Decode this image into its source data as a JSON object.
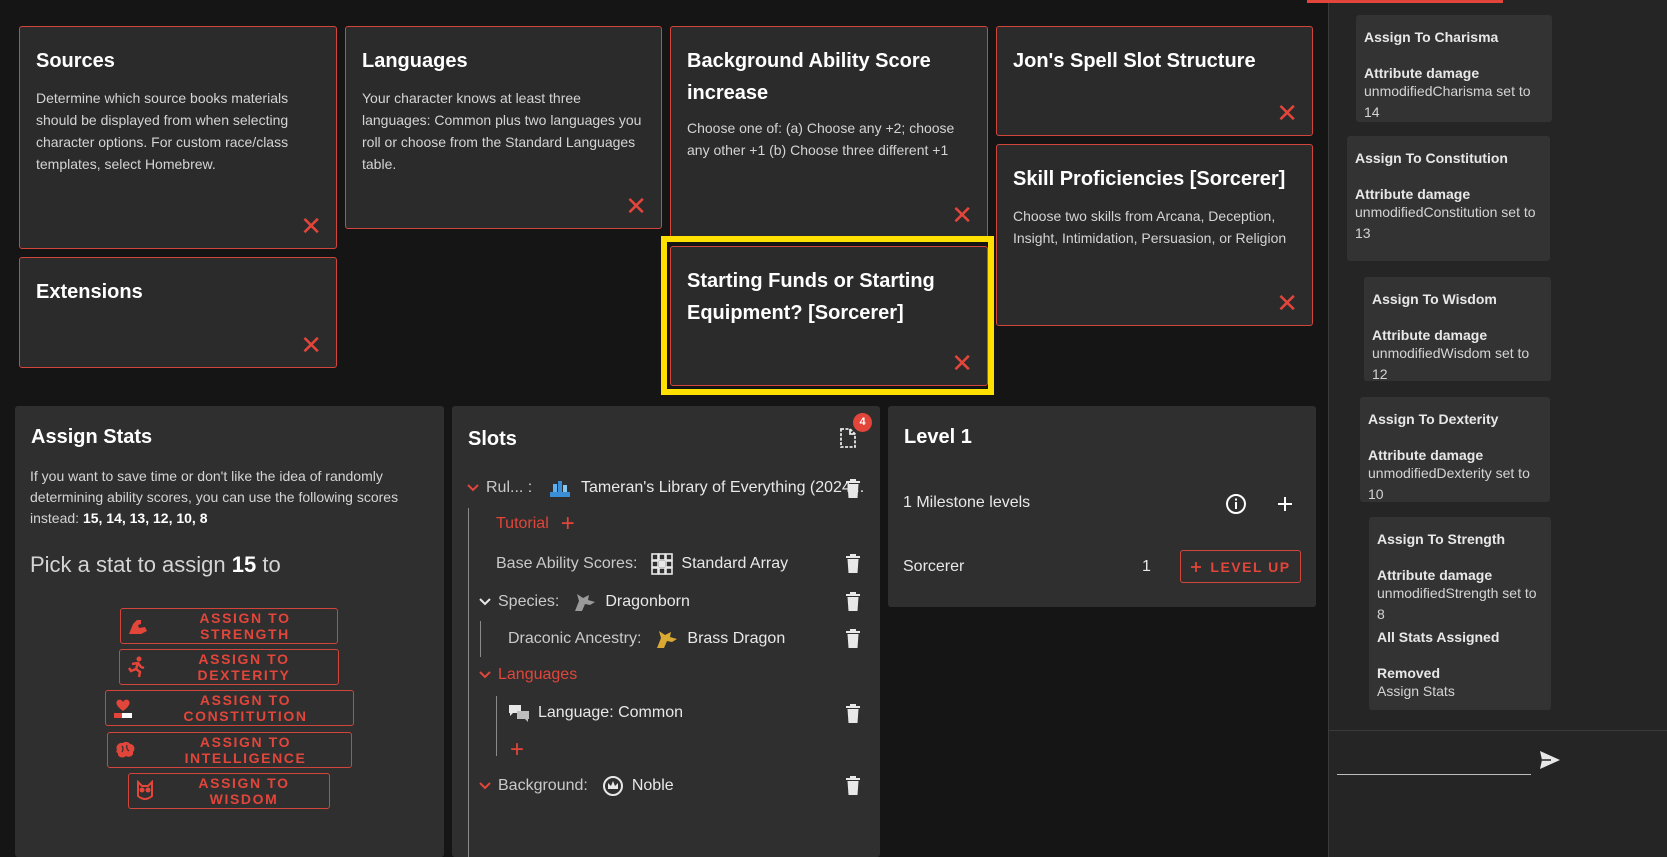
{
  "cards": {
    "sources": {
      "title": "Sources",
      "text": "Determine which source books materials should be displayed from when selecting character options. For custom race/class templates, select Homebrew."
    },
    "languages": {
      "title": "Languages",
      "text": "Your character knows at least three languages: Common plus two languages you roll or choose from the Standard Languages table."
    },
    "background_asi": {
      "title": "Background Ability Score increase",
      "text": "Choose one of: (a) Choose any +2; choose any other +1 (b) Choose three different +1"
    },
    "spell_slot": {
      "title": "Jon's Spell Slot Structure"
    },
    "skill_prof": {
      "title": "Skill Proficiencies [Sorcerer]",
      "text": "Choose two skills from Arcana, Deception, Insight, Intimidation, Persuasion, or Religion"
    },
    "extensions": {
      "title": "Extensions"
    },
    "starting_funds": {
      "title": "Starting Funds or Starting Equipment? [Sorcerer]"
    },
    "close_glyph": "✕"
  },
  "assign_stats": {
    "title": "Assign Stats",
    "intro": "If you want to save time or don't like the idea of randomly determining ability scores, you can use the following scores instead:",
    "scores": "15, 14, 13, 12, 10, 8",
    "pick_prefix": "Pick a stat to assign",
    "pick_value": "15",
    "pick_suffix": "to",
    "buttons": [
      {
        "label": "ASSIGN TO STRENGTH",
        "icon": "flexed-arm-icon"
      },
      {
        "label": "ASSIGN TO DEXTERITY",
        "icon": "running-figure-icon"
      },
      {
        "label": "ASSIGN TO CONSTITUTION",
        "icon": "heart-bar-icon"
      },
      {
        "label": "ASSIGN TO INTELLIGENCE",
        "icon": "brain-icon"
      },
      {
        "label": "ASSIGN TO WISDOM",
        "icon": "owl-icon"
      }
    ]
  },
  "slots": {
    "title": "Slots",
    "badge": "4",
    "rules_key": "Rul... :",
    "rules_value": "Tameran's Library of Everything (2024...",
    "tutorial": "Tutorial",
    "base_key": "Base Ability Scores:",
    "base_value": "Standard Array",
    "species_key": "Species:",
    "species_value": "Dragonborn",
    "ancestry_key": "Draconic Ancestry:",
    "ancestry_value": "Brass Dragon",
    "languages": "Languages",
    "language_value": "Language: Common",
    "background_key": "Background:",
    "background_value": "Noble",
    "add_glyph": "+"
  },
  "level": {
    "title": "Level 1",
    "milestone": "1 Milestone levels",
    "class_name": "Sorcerer",
    "class_level": "1",
    "level_up": "LEVEL UP"
  },
  "log": [
    {
      "title": "Assign To Charisma",
      "sub": "Attribute damage",
      "value": "unmodifiedCharisma set to 14"
    },
    {
      "title": "Assign To Constitution",
      "sub": "Attribute damage",
      "value": "unmodifiedConstitution set to 13"
    },
    {
      "title": "Assign To Wisdom",
      "sub": "Attribute damage",
      "value": "unmodifiedWisdom set to 12"
    },
    {
      "title": "Assign To Dexterity",
      "sub": "Attribute damage",
      "value": "unmodifiedDexterity set to 10"
    },
    {
      "title": "Assign To Strength",
      "sub": "Attribute damage",
      "value": "unmodifiedStrength set to 8",
      "sub2": "All Stats Assigned",
      "sub3": "Removed",
      "value3": "Assign Stats"
    }
  ],
  "colors": {
    "accent": "#e2453a",
    "highlight": "#ffe000"
  }
}
